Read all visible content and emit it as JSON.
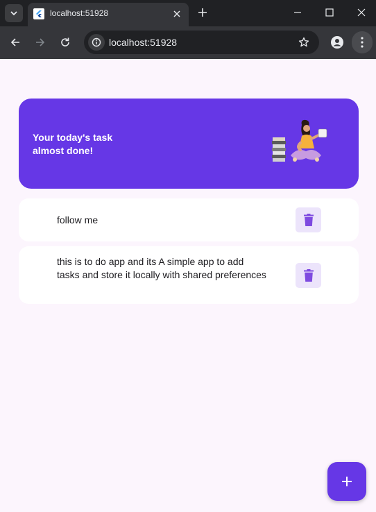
{
  "browser": {
    "tab_title": "localhost:51928",
    "url": "localhost:51928"
  },
  "banner": {
    "line1": "Your today's task",
    "line2": "almost done!"
  },
  "tasks": [
    {
      "text": "follow me"
    },
    {
      "text": "this is to do app and its A simple app to add tasks and store it locally with shared preferences"
    }
  ],
  "colors": {
    "accent": "#6637e6",
    "delete_bg": "#ece4fb",
    "page_bg": "#fcf5fd",
    "delete_icon": "#7e4ae0"
  },
  "icons": {
    "fab": "add-icon",
    "delete": "trash-icon"
  }
}
